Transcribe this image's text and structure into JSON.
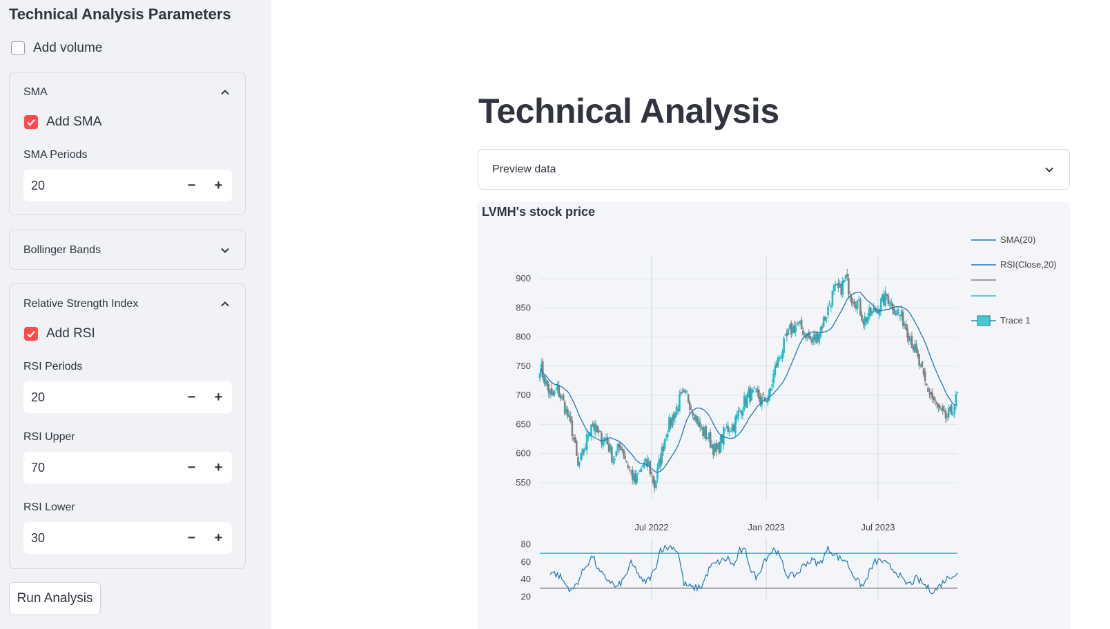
{
  "sidebar": {
    "title": "Technical Analysis Parameters",
    "volume": {
      "label": "Add volume",
      "checked": false
    },
    "sma": {
      "header": "SMA",
      "expanded": true,
      "add_label": "Add SMA",
      "add_checked": true,
      "periods_label": "SMA Periods",
      "periods_value": "20"
    },
    "bollinger": {
      "header": "Bollinger Bands",
      "expanded": false
    },
    "rsi": {
      "header": "Relative Strength Index",
      "expanded": true,
      "add_label": "Add RSI",
      "add_checked": true,
      "periods_label": "RSI Periods",
      "periods_value": "20",
      "upper_label": "RSI Upper",
      "upper_value": "70",
      "lower_label": "RSI Lower",
      "lower_value": "30"
    },
    "step_minus": "−",
    "step_plus": "+",
    "run_button": "Run Analysis"
  },
  "main": {
    "title": "Technical Analysis",
    "preview_label": "Preview data"
  },
  "chart_data": {
    "type": "candlestick",
    "title": "LVMH's stock price",
    "x_ticks": [
      "Jul 2022",
      "Jan 2023",
      "Jul 2023"
    ],
    "price_axis": {
      "ticks": [
        550,
        600,
        650,
        700,
        750,
        800,
        850,
        900
      ],
      "range": [
        525,
        925
      ]
    },
    "rsi_axis": {
      "ticks": [
        20,
        40,
        60,
        80
      ],
      "range": [
        18,
        82
      ]
    },
    "legend": [
      "SMA(20)",
      "RSI(Close,20)",
      "",
      "",
      "Trace 1"
    ],
    "legend_placement": "top-right",
    "colors": {
      "increasing": "#17becf",
      "decreasing": "#7f7f7f",
      "sma": "#1f77b4",
      "rsi_upper": "#17becf",
      "rsi_lower": "#7f7f7f"
    },
    "rsi_upper": 70,
    "rsi_lower": 30,
    "close_anchors": [
      [
        0,
        750
      ],
      [
        4,
        722
      ],
      [
        8,
        695
      ],
      [
        12,
        710
      ],
      [
        17,
        680
      ],
      [
        22,
        640
      ],
      [
        26,
        575
      ],
      [
        30,
        605
      ],
      [
        35,
        655
      ],
      [
        40,
        630
      ],
      [
        45,
        625
      ],
      [
        50,
        590
      ],
      [
        55,
        615
      ],
      [
        60,
        580
      ],
      [
        65,
        550
      ],
      [
        70,
        580
      ],
      [
        74,
        580
      ],
      [
        78,
        545
      ],
      [
        82,
        590
      ],
      [
        86,
        640
      ],
      [
        90,
        660
      ],
      [
        95,
        690
      ],
      [
        100,
        700
      ],
      [
        105,
        670
      ],
      [
        110,
        640
      ],
      [
        115,
        625
      ],
      [
        120,
        600
      ],
      [
        126,
        640
      ],
      [
        132,
        650
      ],
      [
        137,
        680
      ],
      [
        142,
        700
      ],
      [
        147,
        700
      ],
      [
        152,
        690
      ],
      [
        156,
        700
      ],
      [
        160,
        745
      ],
      [
        165,
        780
      ],
      [
        170,
        810
      ],
      [
        175,
        820
      ],
      [
        180,
        810
      ],
      [
        185,
        790
      ],
      [
        190,
        810
      ],
      [
        195,
        840
      ],
      [
        200,
        880
      ],
      [
        204,
        880
      ],
      [
        208,
        900
      ],
      [
        212,
        870
      ],
      [
        216,
        860
      ],
      [
        220,
        830
      ],
      [
        226,
        840
      ],
      [
        231,
        855
      ],
      [
        236,
        870
      ],
      [
        241,
        850
      ],
      [
        247,
        830
      ],
      [
        252,
        800
      ],
      [
        257,
        760
      ],
      [
        262,
        720
      ],
      [
        266,
        700
      ],
      [
        270,
        680
      ],
      [
        275,
        660
      ],
      [
        280,
        670
      ],
      [
        284,
        700
      ]
    ],
    "rsi_anchors": [
      [
        0,
        45
      ],
      [
        8,
        49
      ],
      [
        14,
        43
      ],
      [
        18,
        33
      ],
      [
        22,
        27
      ],
      [
        26,
        38
      ],
      [
        31,
        55
      ],
      [
        36,
        67
      ],
      [
        40,
        50
      ],
      [
        44,
        42
      ],
      [
        48,
        38
      ],
      [
        52,
        30
      ],
      [
        57,
        40
      ],
      [
        62,
        58
      ],
      [
        66,
        50
      ],
      [
        70,
        36
      ],
      [
        74,
        40
      ],
      [
        78,
        50
      ],
      [
        82,
        75
      ],
      [
        86,
        76
      ],
      [
        90,
        78
      ],
      [
        94,
        72
      ],
      [
        98,
        35
      ],
      [
        104,
        30
      ],
      [
        110,
        32
      ],
      [
        116,
        55
      ],
      [
        122,
        60
      ],
      [
        128,
        64
      ],
      [
        132,
        55
      ],
      [
        136,
        73
      ],
      [
        140,
        72
      ],
      [
        144,
        49
      ],
      [
        148,
        42
      ],
      [
        152,
        61
      ],
      [
        156,
        69
      ],
      [
        160,
        76
      ],
      [
        164,
        62
      ],
      [
        168,
        45
      ],
      [
        172,
        44
      ],
      [
        176,
        48
      ],
      [
        180,
        58
      ],
      [
        186,
        62
      ],
      [
        190,
        57
      ],
      [
        196,
        75
      ],
      [
        200,
        70
      ],
      [
        204,
        64
      ],
      [
        208,
        62
      ],
      [
        212,
        49
      ],
      [
        216,
        38
      ],
      [
        220,
        32
      ],
      [
        224,
        48
      ],
      [
        228,
        60
      ],
      [
        232,
        62
      ],
      [
        236,
        57
      ],
      [
        240,
        52
      ],
      [
        244,
        46
      ],
      [
        248,
        36
      ],
      [
        252,
        35
      ],
      [
        256,
        41
      ],
      [
        260,
        36
      ],
      [
        264,
        30
      ],
      [
        268,
        26
      ],
      [
        272,
        33
      ],
      [
        276,
        40
      ],
      [
        280,
        45
      ],
      [
        284,
        46
      ]
    ]
  }
}
